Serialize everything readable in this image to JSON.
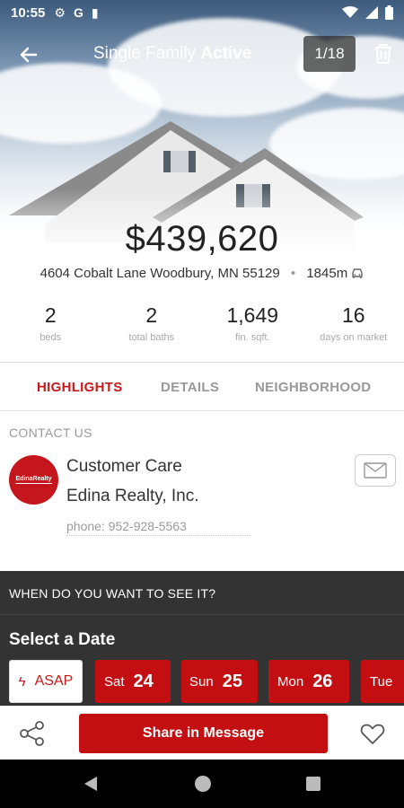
{
  "status_bar": {
    "time": "10:55",
    "icons": [
      "settings-icon",
      "google-icon",
      "clipboard-icon",
      "wifi-icon",
      "signal-icon",
      "battery-icon"
    ]
  },
  "header": {
    "title_type": "Single Family",
    "title_status": "Active",
    "photo_counter": "1/18"
  },
  "listing": {
    "price": "$439,620",
    "address": "4604 Cobalt Lane Woodbury, MN 55129",
    "separator": "•",
    "drive_time": "1845m"
  },
  "stats": [
    {
      "value": "2",
      "label": "beds"
    },
    {
      "value": "2",
      "label": "total baths"
    },
    {
      "value": "1,649",
      "label": "fin. sqft."
    },
    {
      "value": "16",
      "label": "days on market"
    }
  ],
  "tabs": [
    {
      "label": "HIGHLIGHTS",
      "active": true
    },
    {
      "label": "DETAILS",
      "active": false
    },
    {
      "label": "NEIGHBORHOOD",
      "active": false
    }
  ],
  "contact": {
    "section_title": "CONTACT US",
    "logo_text": "EdinaRealty",
    "name": "Customer Care",
    "company": "Edina Realty, Inc.",
    "phone": "phone: 952-928-5563"
  },
  "schedule": {
    "question": "WHEN DO YOU WANT TO SEE IT?",
    "select_label": "Select a Date",
    "asap_label": "ASAP",
    "dates": [
      {
        "day": "Sat",
        "num": "24"
      },
      {
        "day": "Sun",
        "num": "25"
      },
      {
        "day": "Mon",
        "num": "26"
      },
      {
        "day": "Tue",
        "num": ""
      }
    ]
  },
  "actions": {
    "share_message_label": "Share in Message"
  },
  "colors": {
    "accent": "#c40f12",
    "dark_panel": "#333333"
  }
}
